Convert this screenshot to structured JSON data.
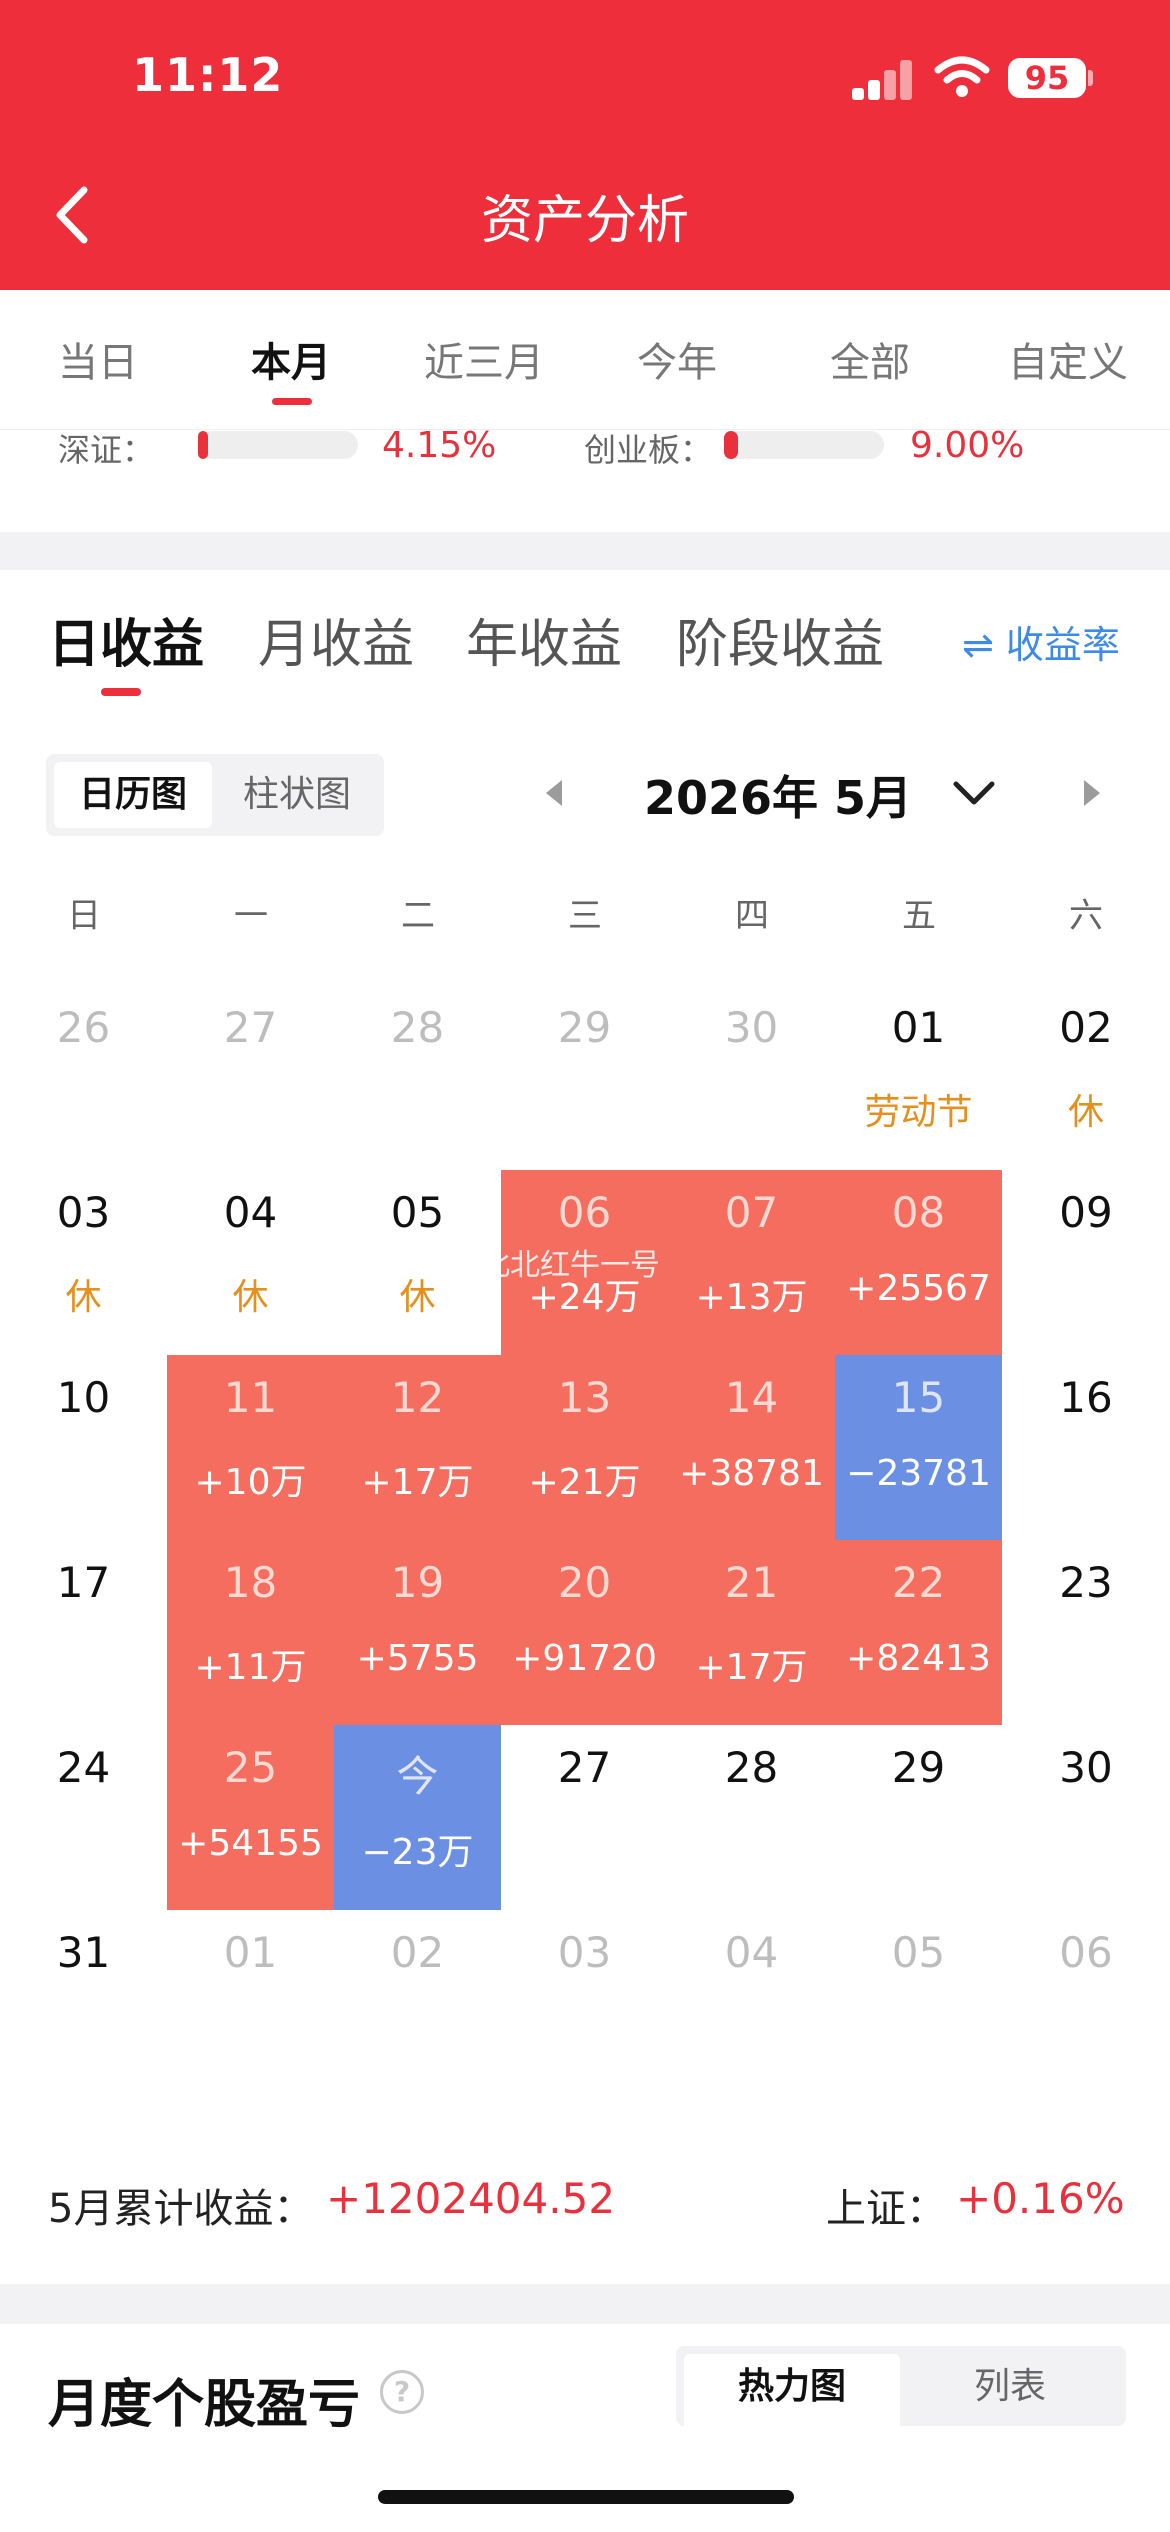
{
  "status_bar": {
    "time": "11:12",
    "battery": "95"
  },
  "header": {
    "title": "资产分析"
  },
  "period_tabs": [
    {
      "label": "当日"
    },
    {
      "label": "本月"
    },
    {
      "label": "近三月"
    },
    {
      "label": "今年"
    },
    {
      "label": "全部"
    },
    {
      "label": "自定义"
    }
  ],
  "period_active": "本月",
  "indices": [
    {
      "label": "深证：",
      "value": "4.15%",
      "fill": 0.04
    },
    {
      "label": "创业板：",
      "value": "9.00%",
      "fill": 0.09
    }
  ],
  "income_tabs": [
    {
      "label": "日收益"
    },
    {
      "label": "月收益"
    },
    {
      "label": "年收益"
    },
    {
      "label": "阶段收益"
    }
  ],
  "rate_toggle": "⇌ 收益率",
  "view_switch": {
    "calendar": "日历图",
    "bar": "柱状图"
  },
  "month": {
    "label": "2026年 5月"
  },
  "weekdays": [
    "日",
    "一",
    "二",
    "三",
    "四",
    "五",
    "六"
  ],
  "calendar_rows": [
    [
      {
        "day": "26",
        "sub": "",
        "state": "muted"
      },
      {
        "day": "27",
        "sub": "",
        "state": "muted"
      },
      {
        "day": "28",
        "sub": "",
        "state": "muted"
      },
      {
        "day": "29",
        "sub": "",
        "state": "muted"
      },
      {
        "day": "30",
        "sub": "",
        "state": "muted"
      },
      {
        "day": "01",
        "sub": "劳动节",
        "state": "holiday"
      },
      {
        "day": "02",
        "sub": "休",
        "state": "holiday"
      }
    ],
    [
      {
        "day": "03",
        "sub": "休",
        "state": "holiday"
      },
      {
        "day": "04",
        "sub": "休",
        "state": "holiday"
      },
      {
        "day": "05",
        "sub": "休",
        "state": "holiday"
      },
      {
        "day": "06",
        "sub": "+24万",
        "state": "gain"
      },
      {
        "day": "07",
        "sub": "+13万",
        "state": "gain"
      },
      {
        "day": "08",
        "sub": "+25567",
        "state": "gain"
      },
      {
        "day": "09",
        "sub": "",
        "state": "normal"
      }
    ],
    [
      {
        "day": "10",
        "sub": "",
        "state": "normal"
      },
      {
        "day": "11",
        "sub": "+10万",
        "state": "gain"
      },
      {
        "day": "12",
        "sub": "+17万",
        "state": "gain"
      },
      {
        "day": "13",
        "sub": "+21万",
        "state": "gain"
      },
      {
        "day": "14",
        "sub": "+38781",
        "state": "gain"
      },
      {
        "day": "15",
        "sub": "−23781",
        "state": "loss"
      },
      {
        "day": "16",
        "sub": "",
        "state": "normal"
      }
    ],
    [
      {
        "day": "17",
        "sub": "",
        "state": "normal"
      },
      {
        "day": "18",
        "sub": "+11万",
        "state": "gain"
      },
      {
        "day": "19",
        "sub": "+5755",
        "state": "gain"
      },
      {
        "day": "20",
        "sub": "+91720",
        "state": "gain"
      },
      {
        "day": "21",
        "sub": "+17万",
        "state": "gain"
      },
      {
        "day": "22",
        "sub": "+82413",
        "state": "gain"
      },
      {
        "day": "23",
        "sub": "",
        "state": "normal"
      }
    ],
    [
      {
        "day": "24",
        "sub": "",
        "state": "normal"
      },
      {
        "day": "25",
        "sub": "+54155",
        "state": "gain"
      },
      {
        "day": "今",
        "sub": "−23万",
        "state": "loss"
      },
      {
        "day": "27",
        "sub": "",
        "state": "normal"
      },
      {
        "day": "28",
        "sub": "",
        "state": "normal"
      },
      {
        "day": "29",
        "sub": "",
        "state": "normal"
      },
      {
        "day": "30",
        "sub": "",
        "state": "normal"
      }
    ],
    [
      {
        "day": "31",
        "sub": "",
        "state": "normal"
      },
      {
        "day": "01",
        "sub": "",
        "state": "muted"
      },
      {
        "day": "02",
        "sub": "",
        "state": "muted"
      },
      {
        "day": "03",
        "sub": "",
        "state": "muted"
      },
      {
        "day": "04",
        "sub": "",
        "state": "muted"
      },
      {
        "day": "05",
        "sub": "",
        "state": "muted"
      },
      {
        "day": "06",
        "sub": "",
        "state": "muted"
      }
    ]
  ],
  "watermark": "@北北红牛一号",
  "summary": {
    "label": "5月累计收益：",
    "value": "+1202404.52",
    "sh_label": "上证：",
    "sh_value": "+0.16%"
  },
  "stock_section": {
    "title": "月度个股盈亏",
    "help": "?",
    "heatmap": "热力图",
    "list": "列表"
  },
  "colors": {
    "brand_red": "#ee2e3b",
    "gain": "#f46d5e",
    "loss": "#6b8fe3",
    "holiday": "#e5901c",
    "link_blue": "#3d8ae8"
  }
}
